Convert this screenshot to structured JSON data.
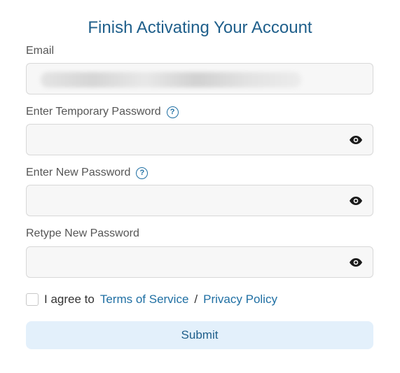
{
  "title": "Finish Activating Your Account",
  "email": {
    "label": "Email",
    "value": ""
  },
  "temp_password": {
    "label": "Enter Temporary Password",
    "value": "",
    "help_icon": "?"
  },
  "new_password": {
    "label": "Enter New Password",
    "value": "",
    "help_icon": "?"
  },
  "retype_password": {
    "label": "Retype New Password",
    "value": ""
  },
  "agreement": {
    "prefix": "I agree to",
    "terms_link": "Terms of Service",
    "separator": "/",
    "privacy_link": "Privacy Policy",
    "checked": false
  },
  "submit_label": "Submit",
  "icons": {
    "eye": "eye-icon",
    "help": "help-icon"
  },
  "colors": {
    "accent": "#1f6fa3",
    "title": "#1f5f8b",
    "submit_bg": "#e3f0fb",
    "field_bg": "#f7f7f7"
  }
}
